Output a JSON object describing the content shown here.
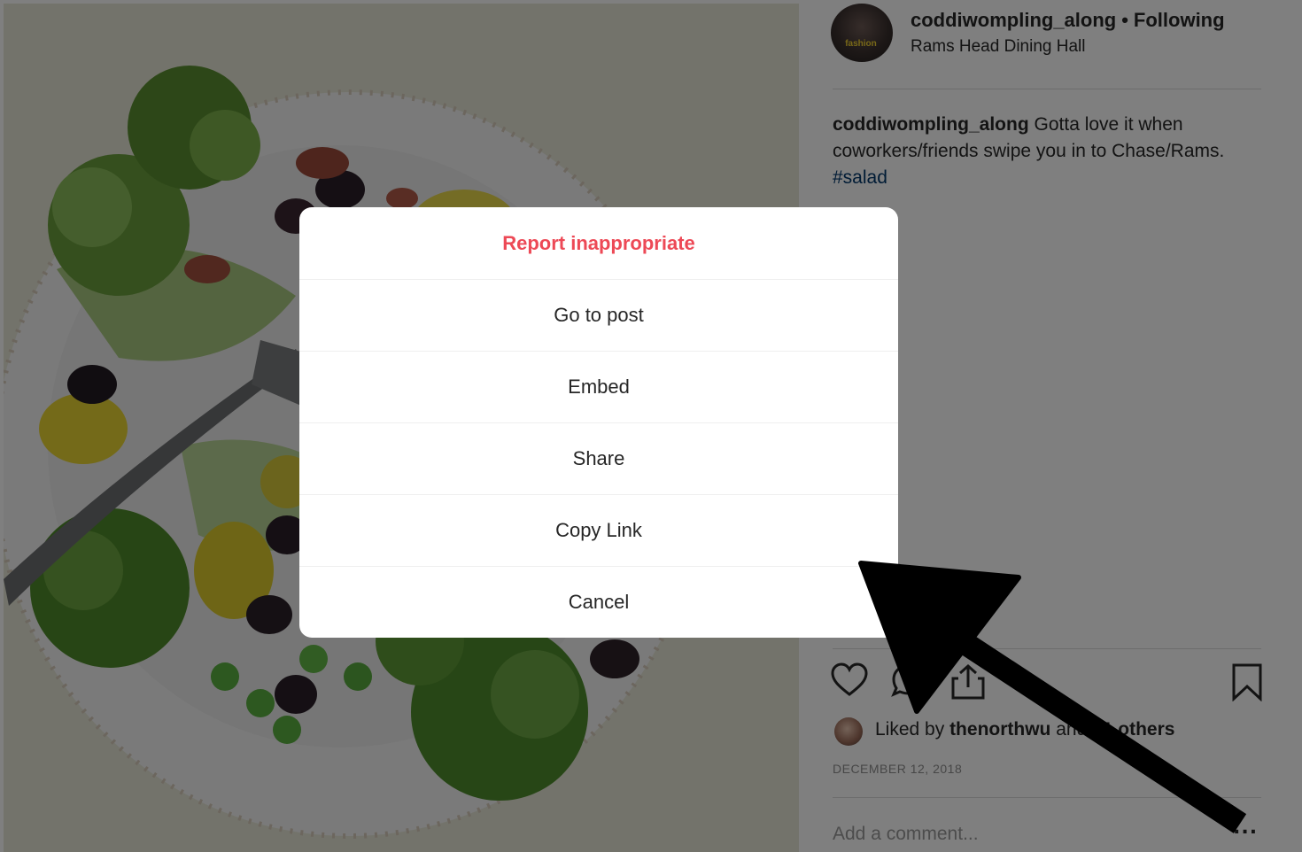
{
  "post": {
    "author": "coddiwompling_along",
    "separator": "•",
    "follow_status": "Following",
    "location": "Rams Head Dining Hall",
    "avatar_badge": "fashion",
    "caption_author": "coddiwompling_along",
    "caption_text": " Gotta love it when coworkers/friends swipe you in to Chase/Rams. ",
    "hashtag": "#salad",
    "likes_prefix": "Liked by ",
    "likes_user": "thenorthwu",
    "likes_middle": " and ",
    "likes_count": "21 others",
    "date": "DECEMBER 12, 2018",
    "comment_placeholder": "Add a comment...",
    "more_options": "..."
  },
  "modal": {
    "items": [
      {
        "label": "Report inappropriate",
        "style": "danger"
      },
      {
        "label": "Go to post"
      },
      {
        "label": "Embed"
      },
      {
        "label": "Share"
      },
      {
        "label": "Copy Link"
      },
      {
        "label": "Cancel"
      }
    ]
  },
  "icons": {
    "like": "heart-icon",
    "comment": "comment-icon",
    "share": "share-icon",
    "save": "bookmark-icon",
    "annotation": "arrow-pointer"
  },
  "colors": {
    "danger": "#ed4956",
    "text": "#262626",
    "muted": "#8e8e8e",
    "hashtag": "#00376b",
    "overlay": "rgba(0,0,0,0.5)"
  }
}
